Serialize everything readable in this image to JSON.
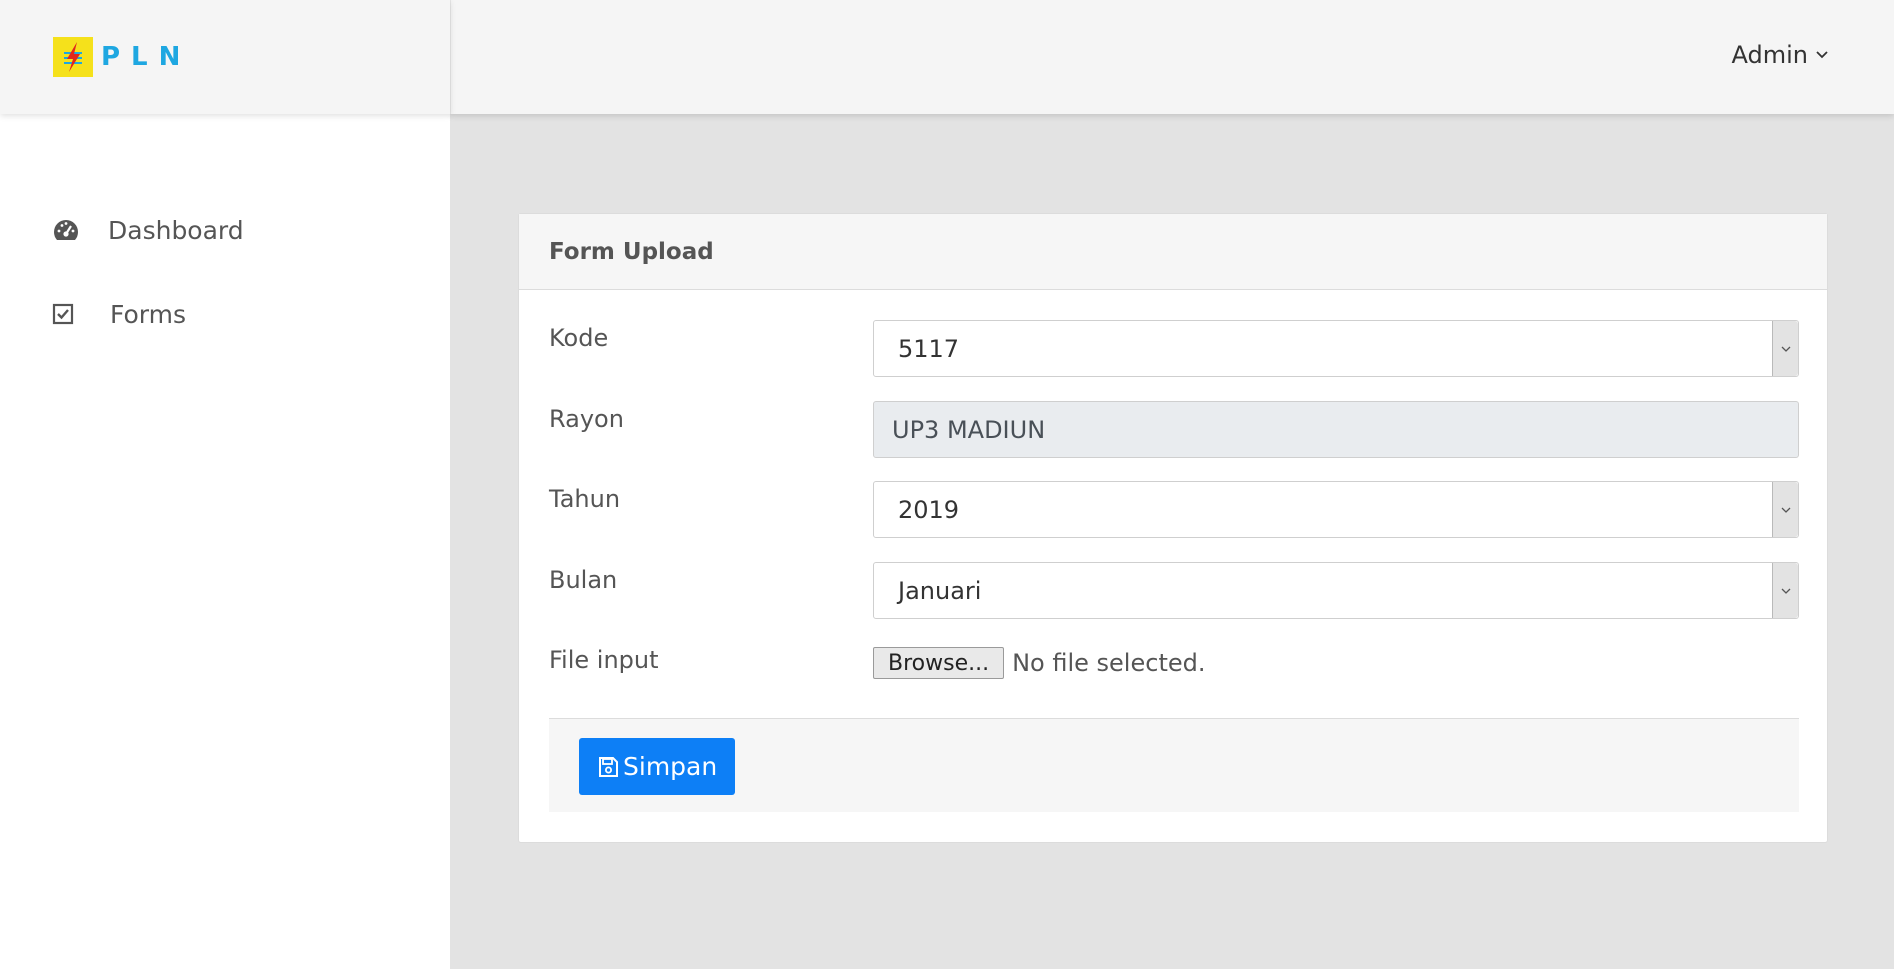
{
  "brand": {
    "name": "PLN"
  },
  "sidebar": {
    "items": [
      {
        "label": "Dashboard",
        "icon": "tachometer-icon"
      },
      {
        "label": "Forms",
        "icon": "checkbox-icon"
      }
    ]
  },
  "header": {
    "user": "Admin"
  },
  "form": {
    "title": "Form Upload",
    "kode": {
      "label": "Kode",
      "value": "5117"
    },
    "rayon": {
      "label": "Rayon",
      "value": "UP3 MADIUN"
    },
    "tahun": {
      "label": "Tahun",
      "value": "2019"
    },
    "bulan": {
      "label": "Bulan",
      "value": "Januari"
    },
    "file": {
      "label": "File input",
      "button": "Browse...",
      "status": "No file selected."
    },
    "submit": "Simpan"
  },
  "colors": {
    "accent": "#0d7ff6",
    "brand": "#1ea7e1",
    "logo_bg": "#f5e11b"
  }
}
